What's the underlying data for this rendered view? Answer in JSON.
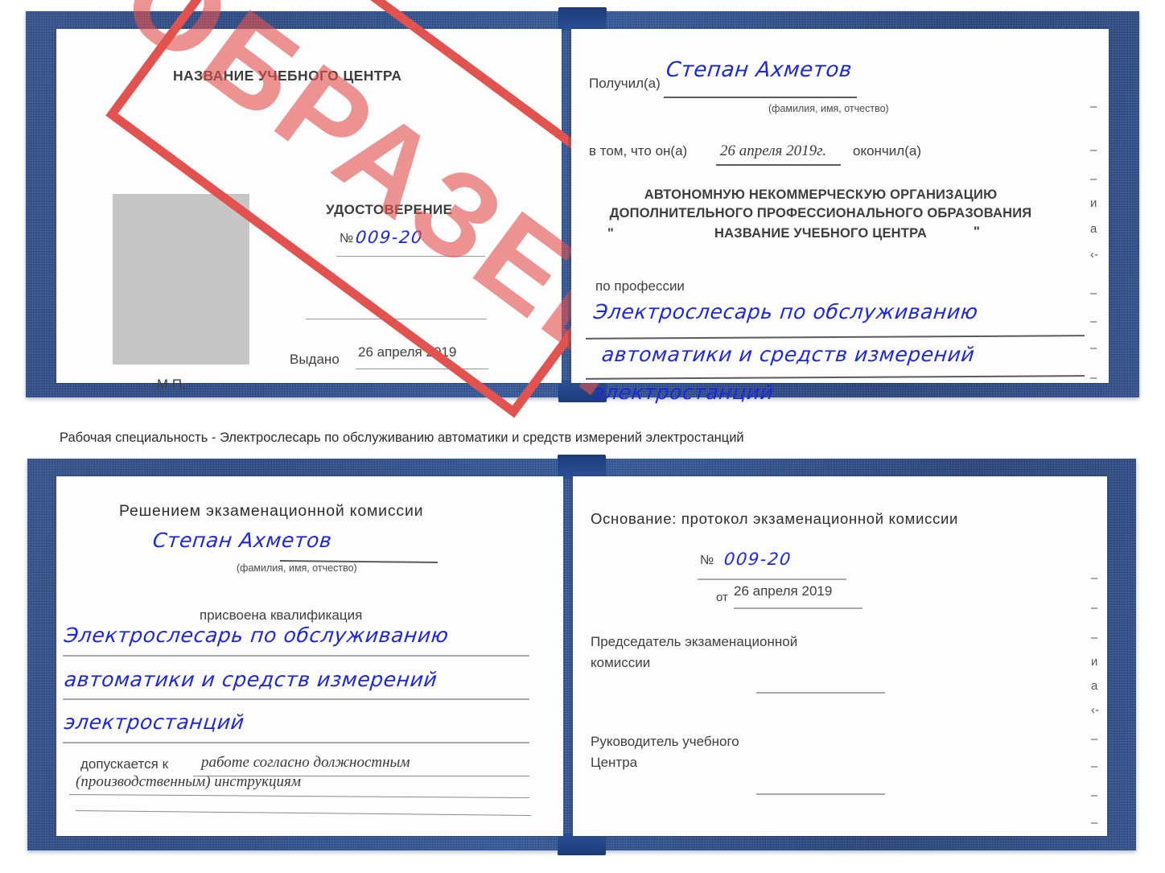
{
  "stamp": {
    "text": "ОБРАЗЕЦ",
    "color": "#e2524f"
  },
  "caption": "Рабочая специальность - Электрослесарь по обслуживанию автоматики и средств измерений электростанций",
  "certificate_top": {
    "left_page": {
      "heading": "НАЗВАНИЕ УЧЕБНОГО ЦЕНТРА",
      "title": "УДОСТОВЕРЕНИЕ",
      "number_label": "№",
      "number_value": "009-20",
      "issued_label": "Выдано",
      "issued_value": "26 апреля 2019",
      "seal_label": "М.П.",
      "photo_placeholder": ""
    },
    "right_page": {
      "received_label": "Получил(а)",
      "received_value": "Степан Ахметов",
      "fio_hint": "(фамилия, имя, отчество)",
      "that_he_label": "в том, что он(а)",
      "date_value": "26 апреля 2019г.",
      "finished_label": "окончил(а)",
      "org_line1": "АВТОНОМНУЮ НЕКОММЕРЧЕСКУЮ ОРГАНИЗАЦИЮ",
      "org_line2": "ДОПОЛНИТЕЛЬНОГО ПРОФЕССИОНАЛЬНОГО ОБРАЗОВАНИЯ",
      "org_quote_open": "\"",
      "org_line3": "НАЗВАНИЕ УЧЕБНОГО ЦЕНТРА",
      "org_quote_close": "\"",
      "profession_label": "по профессии",
      "profession_line1": "Электрослесарь по обслуживанию",
      "profession_line2": "автоматики и средств измерений",
      "profession_line3": "электростанций",
      "edge_chars": [
        "–",
        "–",
        "–",
        "и",
        "а",
        "‹-",
        "–",
        "–",
        "–",
        "–"
      ]
    }
  },
  "certificate_bottom": {
    "left_page": {
      "heading": "Решением экзаменационной комиссии",
      "name_value": "Степан Ахметов",
      "fio_hint": "(фамилия, имя, отчество)",
      "qualification_label": "присвоена квалификация",
      "qualification_line1": "Электрослесарь по обслуживанию",
      "qualification_line2": "автоматики и средств измерений",
      "qualification_line3": "электростанций",
      "allowed_label": "допускается к",
      "allowed_line1": "работе согласно должностным",
      "allowed_line2": "(производственным) инструкциям"
    },
    "right_page": {
      "basis_label": "Основание: протокол экзаменационной комиссии",
      "number_label": "№",
      "number_value": "009-20",
      "date_label": "от",
      "date_value": "26 апреля 2019",
      "chair_line1": "Председатель экзаменационной",
      "chair_line2": "комиссии",
      "head_line1": "Руководитель учебного",
      "head_line2": "Центра",
      "edge_chars": [
        "–",
        "–",
        "–",
        "и",
        "а",
        "‹-",
        "–",
        "–",
        "–",
        "–"
      ]
    }
  }
}
